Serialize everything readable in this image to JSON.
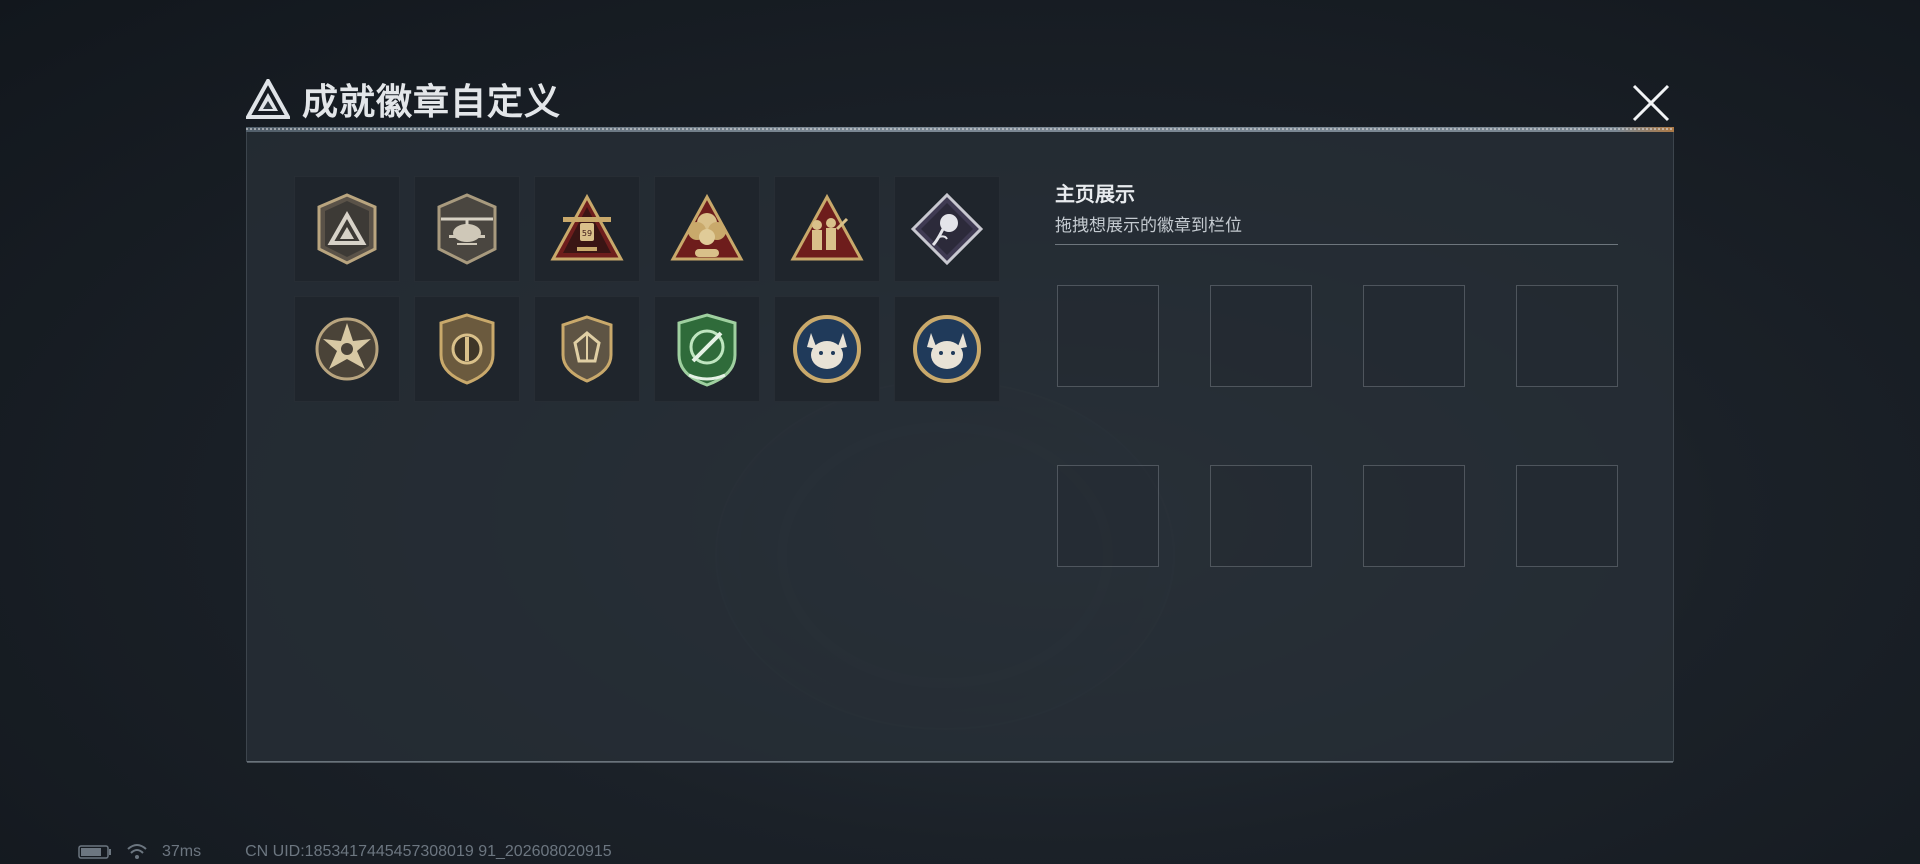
{
  "title": "成就徽章自定义",
  "icons": {
    "title_logo": "triangle-logo-icon",
    "close": "close-icon",
    "battery": "battery-icon",
    "wifi": "wifi-icon"
  },
  "badges": [
    {
      "icon": "shield-logo-badge-icon"
    },
    {
      "icon": "helicopter-badge-icon"
    },
    {
      "icon": "ammo-59-triangle-badge-icon"
    },
    {
      "icon": "explosion-triangle-badge-icon"
    },
    {
      "icon": "soldiers-triangle-badge-icon"
    },
    {
      "icon": "rose-diamond-badge-icon"
    },
    {
      "icon": "star-skull-badge-icon"
    },
    {
      "icon": "bronze-shield-badge-icon"
    },
    {
      "icon": "gem-shield-badge-icon"
    },
    {
      "icon": "green-knife-shield-badge-icon"
    },
    {
      "icon": "lynx-badge-icon"
    },
    {
      "icon": "lynx-alt-badge-icon"
    }
  ],
  "showcase": {
    "title": "主页展示",
    "subtitle": "拖拽想展示的徽章到栏位",
    "slot_count": 8
  },
  "status": {
    "ping": "37ms",
    "uid": "CN UID:1853417445457308019 91_202608020915"
  },
  "colors": {
    "gold": "#c9a96b",
    "dark_red": "#6e1d1c",
    "green": "#2f6b3a",
    "navy": "#203a5a"
  }
}
